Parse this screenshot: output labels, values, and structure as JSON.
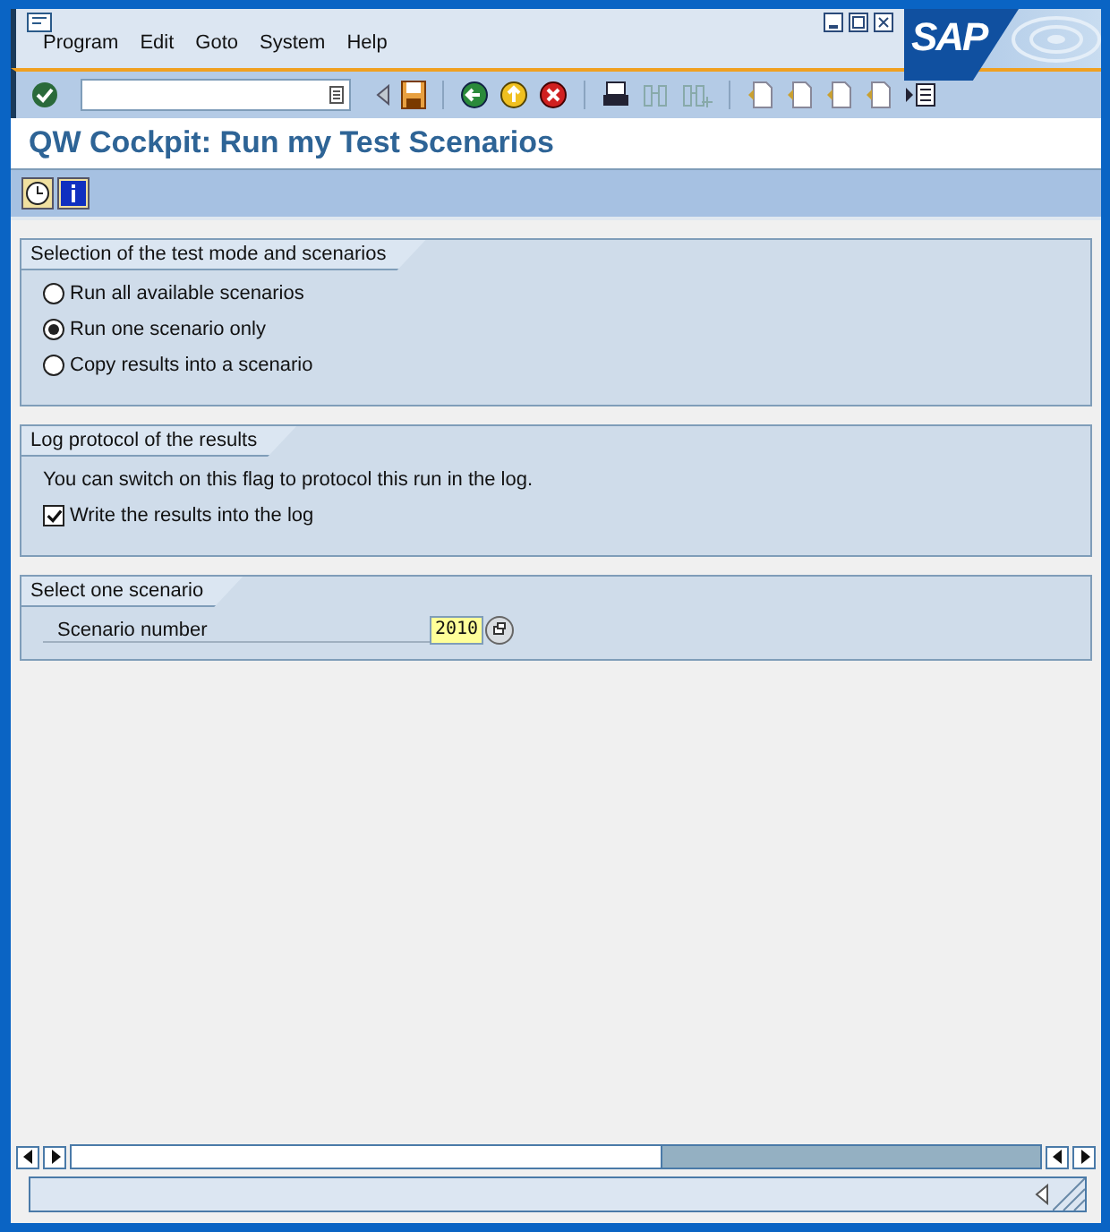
{
  "menu": [
    "Program",
    "Edit",
    "Goto",
    "System",
    "Help"
  ],
  "logo": "SAP",
  "title": "QW Cockpit: Run my Test Scenarios",
  "groups": [
    {
      "title": "Selection of the test mode and scenarios",
      "items": [
        {
          "kind": "radio",
          "label": "Run all available scenarios",
          "selected": false
        },
        {
          "kind": "radio",
          "label": "Run one scenario only",
          "selected": true
        },
        {
          "kind": "radio",
          "label": "Copy results into a scenario",
          "selected": false
        }
      ]
    },
    {
      "title": "Log protocol of the results",
      "items": [
        {
          "kind": "text",
          "label": "You can switch on this flag to protocol this run in the log."
        },
        {
          "kind": "checkbox",
          "label": "Write the results into the log",
          "checked": true
        }
      ]
    },
    {
      "title": "Select one scenario",
      "items": [
        {
          "kind": "field",
          "label": "Scenario number",
          "value": "2010"
        }
      ]
    }
  ]
}
